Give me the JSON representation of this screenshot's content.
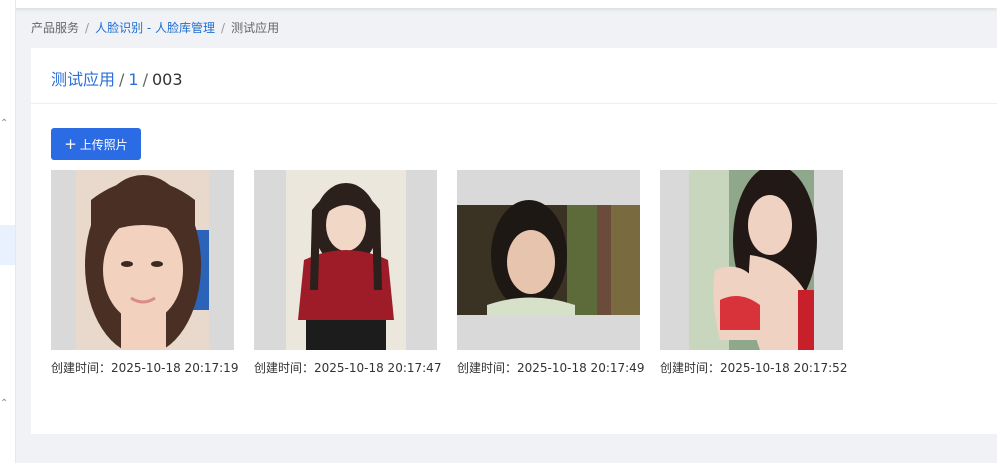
{
  "breadcrumb": {
    "root": "产品服务",
    "sep1": "/",
    "face_lib": "人脸识别 - 人脸库管理",
    "sep2": "/",
    "current": "测试应用"
  },
  "header": {
    "app": "测试应用",
    "sep1": "/",
    "group": "1",
    "sep2": "/",
    "person": "003"
  },
  "toolbar": {
    "plus_icon": "+",
    "upload_label": "上传照片"
  },
  "photos": [
    {
      "caption": "创建时间：2025-10-18 20:17:19",
      "icon": "portrait-photo"
    },
    {
      "caption": "创建时间：2025-10-18 20:17:47",
      "icon": "portrait-photo"
    },
    {
      "caption": "创建时间：2025-10-18 20:17:49",
      "icon": "landscape-photo"
    },
    {
      "caption": "创建时间：2025-10-18 20:17:52",
      "icon": "portrait-photo"
    }
  ],
  "colors": {
    "accent": "#2b6be3",
    "link": "#1f6fd1",
    "placeholder": "#d9d9d9"
  }
}
